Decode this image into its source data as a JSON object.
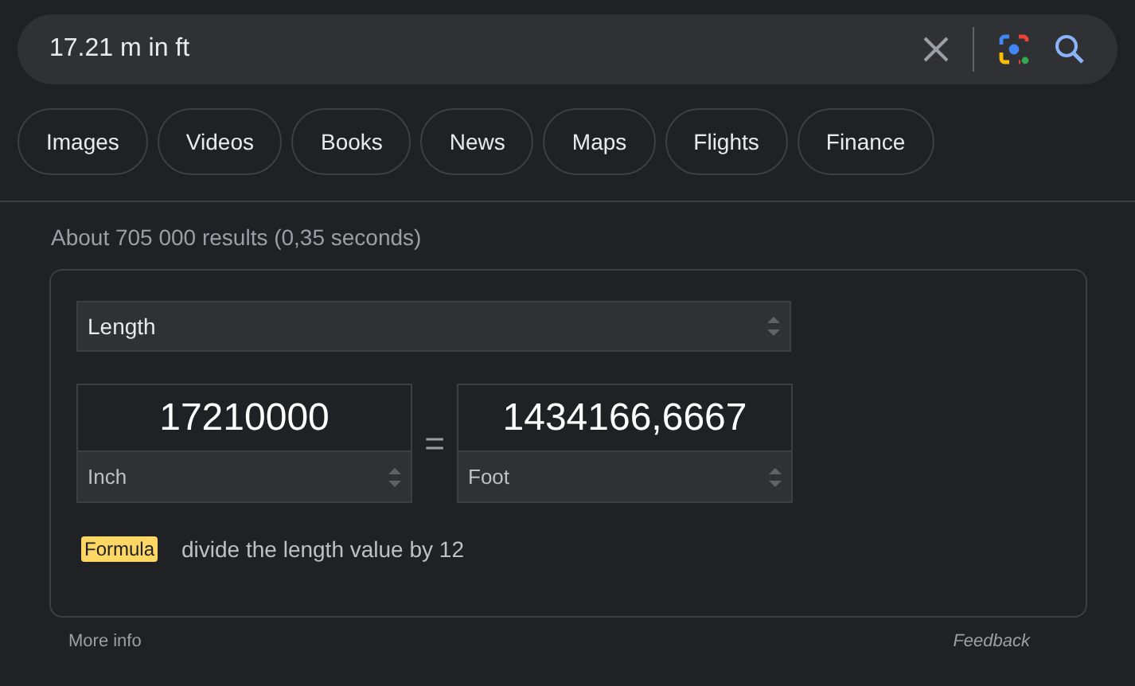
{
  "search": {
    "value": "17.21 m in ft"
  },
  "chips": [
    {
      "label": "Images"
    },
    {
      "label": "Videos"
    },
    {
      "label": "Books"
    },
    {
      "label": "News"
    },
    {
      "label": "Maps"
    },
    {
      "label": "Flights"
    },
    {
      "label": "Finance"
    }
  ],
  "results_info": "About 705 000 results (0,35 seconds)",
  "converter": {
    "quantity": "Length",
    "equals": "=",
    "from": {
      "value": "17210000",
      "unit": "Inch"
    },
    "to": {
      "value": "1434166,6667",
      "unit": "Foot"
    },
    "formula_label": "Formula",
    "formula": "divide the length value by 12"
  },
  "footer": {
    "more_info": "More info",
    "feedback": "Feedback"
  }
}
